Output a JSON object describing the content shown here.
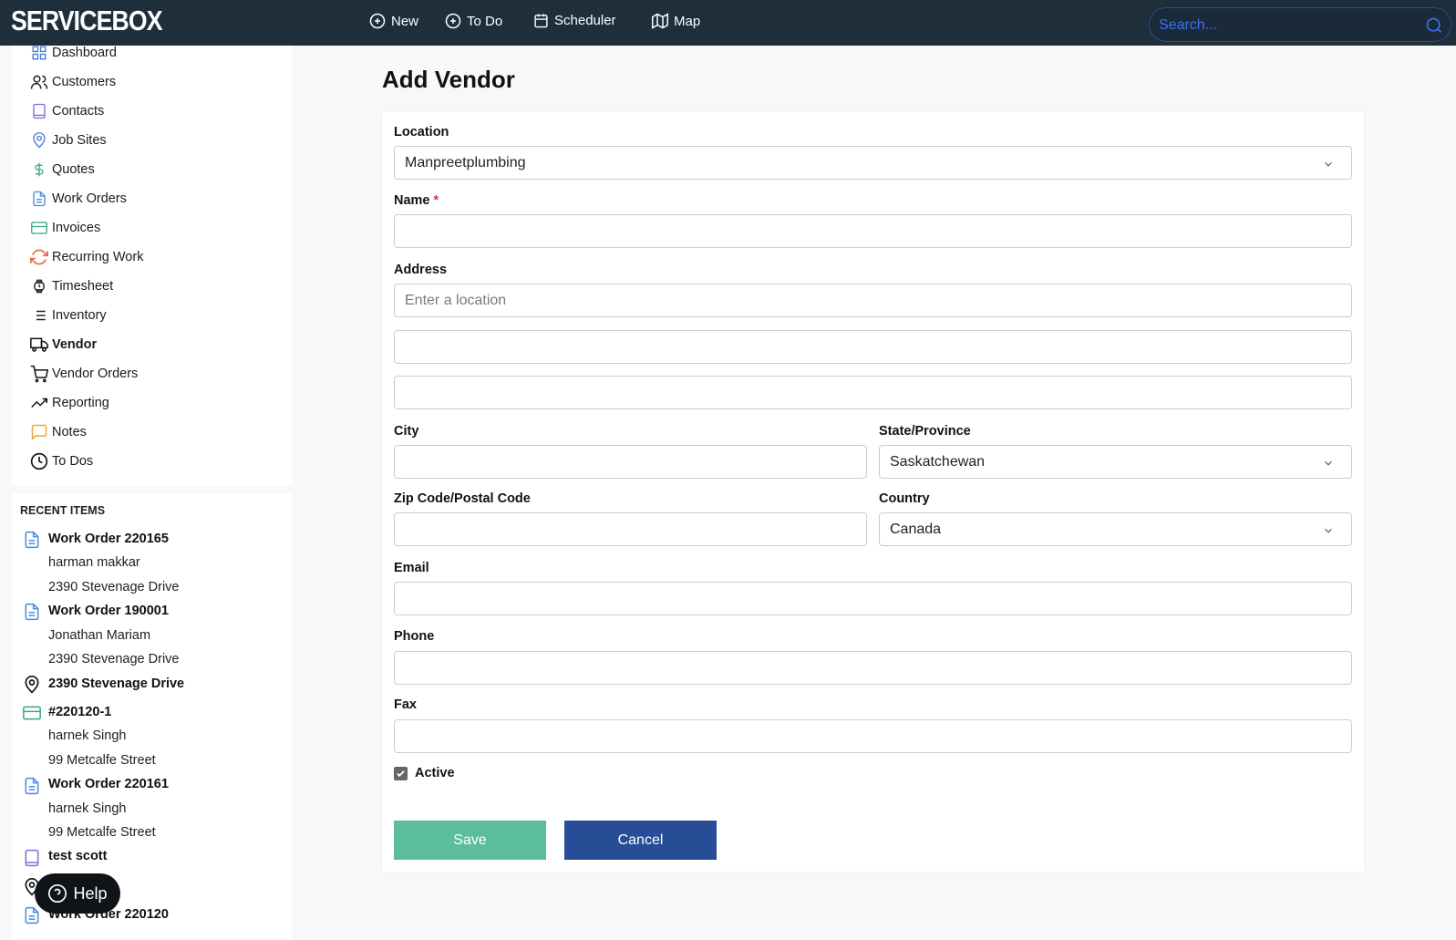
{
  "app": {
    "logo": "SERVICEBOX"
  },
  "topnav": [
    {
      "label": "New",
      "icon": "plus-circle-icon"
    },
    {
      "label": "To Do",
      "icon": "plus-circle-icon"
    },
    {
      "label": "Scheduler",
      "icon": "calendar-icon"
    },
    {
      "label": "Map",
      "icon": "map-icon"
    }
  ],
  "search": {
    "placeholder": "Search..."
  },
  "sidebar": {
    "items": [
      {
        "label": "Dashboard",
        "icon": "grid-icon"
      },
      {
        "label": "Customers",
        "icon": "users-icon"
      },
      {
        "label": "Contacts",
        "icon": "book-icon"
      },
      {
        "label": "Job Sites",
        "icon": "map-pin-icon"
      },
      {
        "label": "Quotes",
        "icon": "dollar-icon"
      },
      {
        "label": "Work Orders",
        "icon": "document-icon"
      },
      {
        "label": "Invoices",
        "icon": "credit-card-icon"
      },
      {
        "label": "Recurring Work",
        "icon": "refresh-icon"
      },
      {
        "label": "Timesheet",
        "icon": "watch-icon"
      },
      {
        "label": "Inventory",
        "icon": "list-icon"
      },
      {
        "label": "Vendor",
        "icon": "truck-icon",
        "active": true
      },
      {
        "label": "Vendor Orders",
        "icon": "cart-icon"
      },
      {
        "label": "Reporting",
        "icon": "trending-up-icon"
      },
      {
        "label": "Notes",
        "icon": "message-square-icon"
      },
      {
        "label": "To Dos",
        "icon": "clock-icon"
      }
    ]
  },
  "recent": {
    "title": "RECENT ITEMS",
    "items": [
      {
        "title": "Work Order 220165",
        "lines": [
          "harman makkar",
          "2390 Stevenage Drive"
        ],
        "icon": "document-icon"
      },
      {
        "title": "Work Order 190001",
        "lines": [
          "Jonathan Mariam",
          "2390 Stevenage Drive"
        ],
        "icon": "document-icon"
      },
      {
        "title": "2390 Stevenage Drive",
        "lines": [],
        "icon": "map-pin-icon"
      },
      {
        "title": "#220120-1",
        "lines": [
          "harnek Singh",
          "99 Metcalfe Street"
        ],
        "icon": "credit-card-icon"
      },
      {
        "title": "Work Order 220161",
        "lines": [
          "harnek Singh",
          "99 Metcalfe Street"
        ],
        "icon": "document-icon"
      },
      {
        "title": "test scott",
        "lines": [],
        "icon": "book-icon"
      },
      {
        "title": "",
        "lines": [],
        "icon": "map-pin-icon"
      },
      {
        "title": "Work Order 220120",
        "lines": [],
        "icon": "document-icon"
      }
    ]
  },
  "help": {
    "label": "Help"
  },
  "form": {
    "title": "Add Vendor",
    "location_label": "Location",
    "location_value": "Manpreetplumbing",
    "name_label": "Name",
    "required_mark": "*",
    "name_value": "",
    "address_label": "Address",
    "address_placeholder": "Enter a location",
    "address1_value": "",
    "address2_value": "",
    "address3_value": "",
    "city_label": "City",
    "city_value": "",
    "state_label": "State/Province",
    "state_value": "Saskatchewan",
    "zip_label": "Zip Code/Postal Code",
    "zip_value": "",
    "country_label": "Country",
    "country_value": "Canada",
    "email_label": "Email",
    "email_value": "",
    "phone_label": "Phone",
    "phone_value": "",
    "fax_label": "Fax",
    "fax_value": "",
    "active_label": "Active",
    "active_checked": true,
    "save_label": "Save",
    "cancel_label": "Cancel"
  },
  "colors": {
    "topbar": "#1f2e3b",
    "save": "#5bbd9d",
    "cancel": "#264d95",
    "search_text": "#3a6ff0"
  }
}
